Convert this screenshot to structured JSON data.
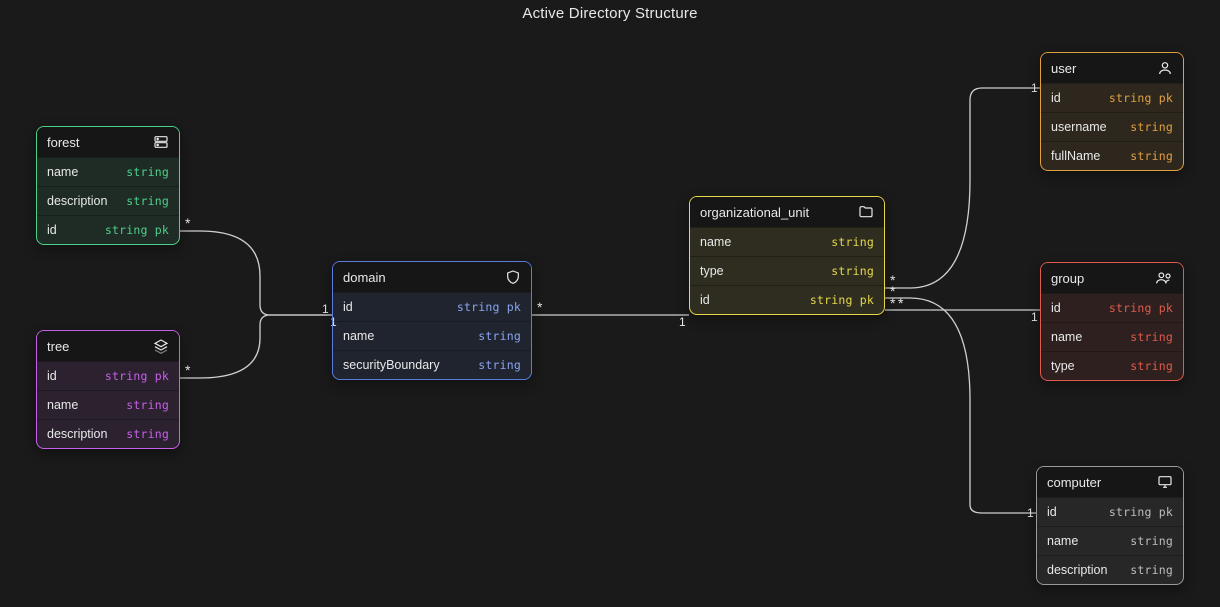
{
  "title": "Active Directory Structure",
  "entities": {
    "forest": {
      "name": "forest",
      "fields": [
        {
          "name": "name",
          "type": "string"
        },
        {
          "name": "description",
          "type": "string"
        },
        {
          "name": "id",
          "type": "string pk"
        }
      ]
    },
    "tree": {
      "name": "tree",
      "fields": [
        {
          "name": "id",
          "type": "string pk"
        },
        {
          "name": "name",
          "type": "string"
        },
        {
          "name": "description",
          "type": "string"
        }
      ]
    },
    "domain": {
      "name": "domain",
      "fields": [
        {
          "name": "id",
          "type": "string pk"
        },
        {
          "name": "name",
          "type": "string"
        },
        {
          "name": "securityBoundary",
          "type": "string"
        }
      ]
    },
    "ou": {
      "name": "organizational_unit",
      "fields": [
        {
          "name": "name",
          "type": "string"
        },
        {
          "name": "type",
          "type": "string"
        },
        {
          "name": "id",
          "type": "string pk"
        }
      ]
    },
    "user": {
      "name": "user",
      "fields": [
        {
          "name": "id",
          "type": "string pk"
        },
        {
          "name": "username",
          "type": "string"
        },
        {
          "name": "fullName",
          "type": "string"
        }
      ]
    },
    "group": {
      "name": "group",
      "fields": [
        {
          "name": "id",
          "type": "string pk"
        },
        {
          "name": "name",
          "type": "string"
        },
        {
          "name": "type",
          "type": "string"
        }
      ]
    },
    "computer": {
      "name": "computer",
      "fields": [
        {
          "name": "id",
          "type": "string pk"
        },
        {
          "name": "name",
          "type": "string"
        },
        {
          "name": "description",
          "type": "string"
        }
      ]
    }
  },
  "relations": [
    {
      "from": "forest",
      "to": "domain",
      "from_card": "*",
      "to_card": "1"
    },
    {
      "from": "tree",
      "to": "domain",
      "from_card": "*",
      "to_card": "1"
    },
    {
      "from": "domain",
      "to": "organizational_unit",
      "from_card": "*",
      "to_card": "1"
    },
    {
      "from": "organizational_unit",
      "to": "user",
      "from_card": "*",
      "to_card": "1"
    },
    {
      "from": "organizational_unit",
      "to": "group",
      "from_card": "**",
      "to_card": "1"
    },
    {
      "from": "organizational_unit",
      "to": "computer",
      "from_card": "*",
      "to_card": "1"
    }
  ],
  "colors": {
    "forest": "#4dd08a",
    "tree": "#c760e8",
    "domain": "#5b7de0",
    "ou": "#e6d84a",
    "user": "#e0a040",
    "group": "#e05a4a",
    "computer": "#9a9a9a",
    "edge": "#cfcfcf",
    "bg": "#1a1a1a"
  }
}
